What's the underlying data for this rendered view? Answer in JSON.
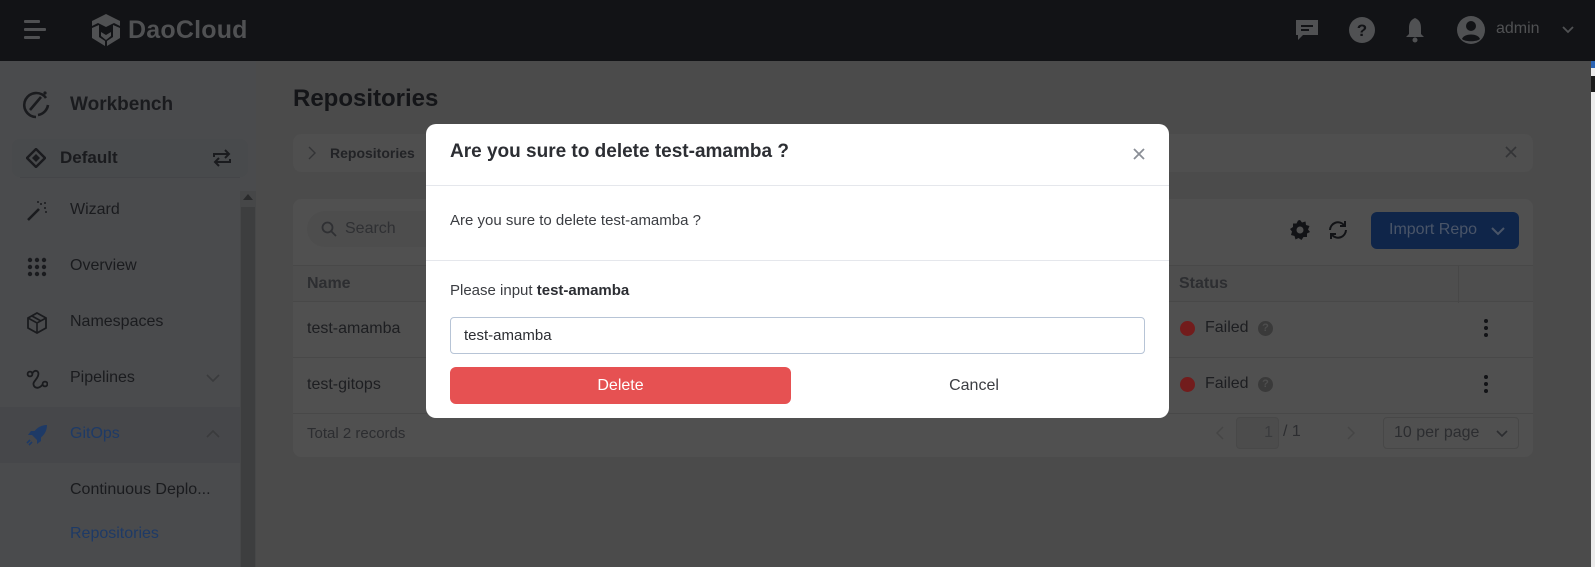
{
  "header": {
    "brand": "DaoCloud",
    "user": "admin",
    "icons": [
      "menu-icon",
      "message-icon",
      "help-icon",
      "bell-icon",
      "user-avatar-icon",
      "chevron-down-icon"
    ]
  },
  "sidebar": {
    "module": "Workbench",
    "workspace": "Default",
    "items": [
      {
        "label": "Wizard",
        "icon": "magic-wand-icon"
      },
      {
        "label": "Overview",
        "icon": "grid-dots-icon"
      },
      {
        "label": "Namespaces",
        "icon": "cube-icon"
      },
      {
        "label": "Pipelines",
        "icon": "pipeline-icon",
        "expandable": true,
        "expanded": false
      },
      {
        "label": "GitOps",
        "icon": "rocket-icon",
        "expandable": true,
        "expanded": true
      }
    ],
    "gitops_children": [
      {
        "label": "Continuous Deplo..."
      },
      {
        "label": "Repositories",
        "active": true
      }
    ]
  },
  "main": {
    "title": "Repositories",
    "breadcrumb": "Repositories",
    "search_placeholder": "Search",
    "import_button": "Import Repo",
    "columns": [
      "Name",
      "Status"
    ],
    "rows": [
      {
        "name": "test-amamba",
        "status": "Failed"
      },
      {
        "name": "test-gitops",
        "status": "Failed"
      }
    ],
    "status_color": "#b3262a",
    "total": "Total 2 records",
    "pagination": {
      "current": "1",
      "total": "/ 1",
      "page_size": "10 per page"
    }
  },
  "modal": {
    "title": "Are you sure to delete test-amamba ?",
    "message": "Are you sure to delete test-amamba ?",
    "prompt_prefix": "Please input ",
    "prompt_name": "test-amamba",
    "input_value": "test-amamba",
    "delete_label": "Delete",
    "cancel_label": "Cancel",
    "danger_color": "#e65152"
  }
}
